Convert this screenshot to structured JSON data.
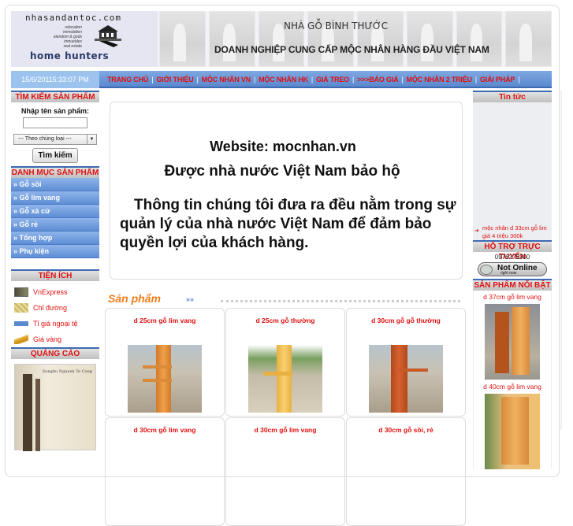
{
  "header": {
    "logo_domain": "nhasandantoc.com",
    "logo_tagline": "home hunters",
    "logo_tags": [
      "relocation",
      "immobilien",
      "eiendom & gods",
      "inmuebles",
      "real estate"
    ],
    "title": "NHÀ GỖ BÌNH THƯỚC",
    "subtitle": "DOANH NGHIỆP CUNG CẤP MỘC NHÂN HÀNG ĐẦU VIỆT NAM"
  },
  "navbar": {
    "datetime": "15/6/20115:33:07 PM",
    "items": [
      {
        "label": "TRANG CHỦ"
      },
      {
        "label": "GIỚI THIỆU"
      },
      {
        "label": "MỘC NHÂN VN"
      },
      {
        "label": "MỘC NHÂN HK"
      },
      {
        "label": "GIÁ TREO"
      },
      {
        "label": ">>>BÁO GIÁ"
      },
      {
        "label": "MỘC NHÂN 2 TRIỆU"
      },
      {
        "label": "GIẢI PHÁP"
      }
    ]
  },
  "search": {
    "heading": "TÌM KIẾM SẢN PHẨM",
    "label": "Nhập tên sản phẩm:",
    "input_value": "",
    "select_value": "--- Theo chủng loại ---",
    "button": "Tìm kiếm"
  },
  "categories": {
    "heading": "DANH MỤC SẢN PHẨM",
    "items": [
      {
        "label": "» Gỗ sồi"
      },
      {
        "label": "» Gỗ lim vang"
      },
      {
        "label": "» Gỗ xà cừ"
      },
      {
        "label": "» Gỗ rẻ"
      },
      {
        "label": "» Tổng hợp"
      },
      {
        "label": "» Phụ kiện"
      }
    ]
  },
  "utilities": {
    "heading": "TIỆN ÍCH",
    "items": [
      {
        "label": "VnExpress",
        "icon": "vnexpress-icon"
      },
      {
        "label": "Chỉ đường",
        "icon": "map-icon"
      },
      {
        "label": "Tỉ giá ngoại tệ",
        "icon": "currency-icon"
      },
      {
        "label": "Giá vàng",
        "icon": "gold-icon"
      }
    ]
  },
  "ads": {
    "heading": "QUẢNG CÁO",
    "caption": "Sunghu Nguyen Te Cong"
  },
  "notice": {
    "line1": "Website: mocnhan.vn",
    "line2": "Được nhà nước Việt Nam bảo hộ",
    "line3": "Thông tin chúng tôi đưa ra đều nằm trong sự quản lý của nhà nước Việt Nam để đảm bảo quyền lợi của khách hàng."
  },
  "products": {
    "heading": "Sản phẩm",
    "more": "»»",
    "items": [
      {
        "name": "d 25cm gỗ lim vang"
      },
      {
        "name": "d 25cm gỗ thường"
      },
      {
        "name": "d 30cm gỗ gỗ thường"
      },
      {
        "name": "d 30cm gỗ lim vang"
      },
      {
        "name": "d 30cm gỗ lim vang"
      },
      {
        "name": "d 30cm gỗ sồi, rẻ"
      }
    ]
  },
  "news": {
    "heading": "Tin tức",
    "items": [
      {
        "label": "mộc nhân d 33cm gỗ lim giá 4 triệu 300k"
      }
    ]
  },
  "support": {
    "heading": "HỖ TRỢ TRỰC TUYẾN",
    "phone": "0976279300",
    "status_main": "Not Online",
    "status_sub": "right now"
  },
  "featured": {
    "heading": "SẢN PHẨM NỔI BẬT",
    "items": [
      {
        "name": "d 37cm gỗ lim vang"
      },
      {
        "name": "d 40cm gỗ lim vang"
      }
    ]
  },
  "colors": {
    "accent_red": "#e01010",
    "nav_blue": "#5b88cf",
    "products_orange": "#ef7d1a"
  }
}
